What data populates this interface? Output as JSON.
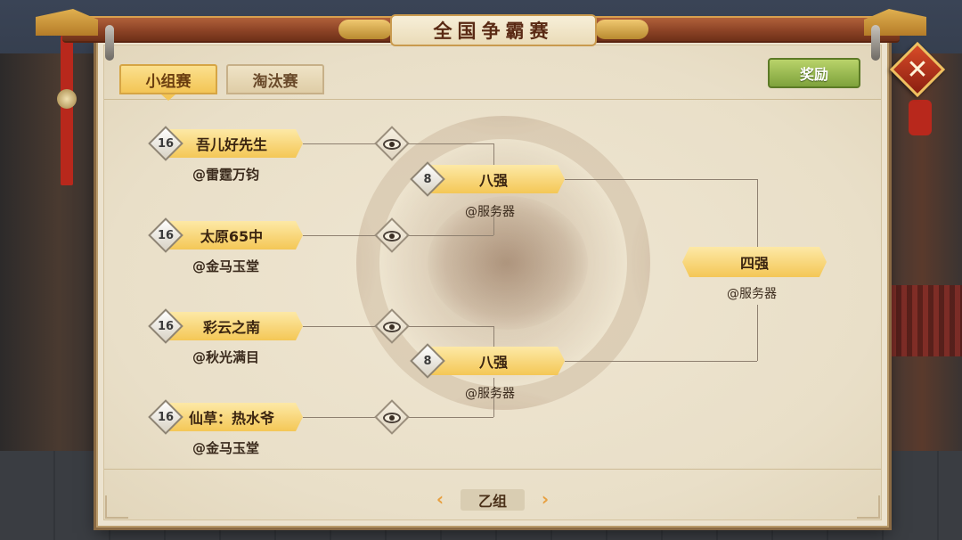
{
  "window": {
    "title": "全国争霸赛"
  },
  "tabs": [
    {
      "label": "小组赛",
      "active": true
    },
    {
      "label": "淘汰赛",
      "active": false
    }
  ],
  "reward_button": "奖励",
  "round16": [
    {
      "seed": "16",
      "name": "吾儿好先生",
      "server": "@雷霆万钧"
    },
    {
      "seed": "16",
      "name": "太原65中",
      "server": "@金马玉堂"
    },
    {
      "seed": "16",
      "name": "彩云之南",
      "server": "@秋光满目"
    },
    {
      "seed": "16",
      "name": "仙草：热水爷",
      "server": "@金马玉堂"
    }
  ],
  "round8": [
    {
      "seed": "8",
      "name": "八强",
      "server": "@服务器"
    },
    {
      "seed": "8",
      "name": "八强",
      "server": "@服务器"
    }
  ],
  "round4": {
    "name": "四强",
    "server": "@服务器"
  },
  "footer": {
    "group": "乙组",
    "prev": "‹",
    "next": "›"
  },
  "close_glyph": "✕"
}
